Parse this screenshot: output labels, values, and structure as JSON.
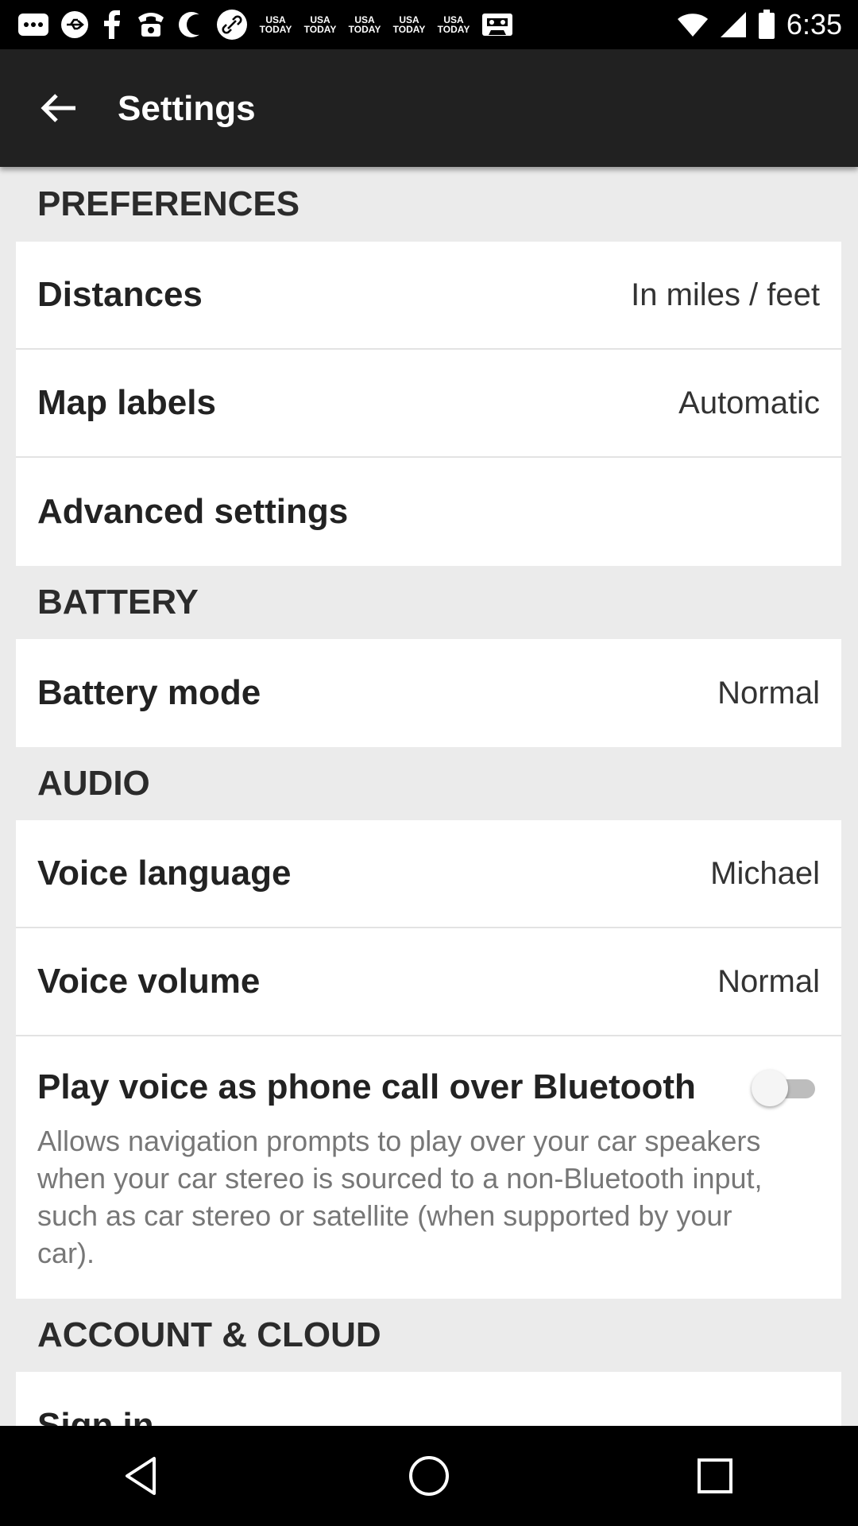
{
  "status_bar": {
    "time": "6:35",
    "notification_icons": [
      "message-icon",
      "usb-icon",
      "facebook-icon",
      "phone-icon",
      "moon-icon",
      "link-icon"
    ],
    "usa_today_text": [
      "USA TODAY",
      "USA TODAY",
      "USA TODAY",
      "USA TODAY",
      "USA TODAY"
    ]
  },
  "app_bar": {
    "title": "Settings"
  },
  "preferences": {
    "header": "PREFERENCES",
    "items": [
      {
        "label": "Distances",
        "value": "In miles / feet"
      },
      {
        "label": "Map labels",
        "value": "Automatic"
      },
      {
        "label": "Advanced settings",
        "value": ""
      }
    ]
  },
  "battery": {
    "header": "BATTERY",
    "items": [
      {
        "label": "Battery mode",
        "value": "Normal"
      }
    ]
  },
  "audio": {
    "header": "AUDIO",
    "items": [
      {
        "label": "Voice language",
        "value": "Michael"
      },
      {
        "label": "Voice volume",
        "value": "Normal"
      }
    ],
    "bluetooth": {
      "label": "Play voice as phone call over Bluetooth",
      "enabled": false,
      "description": "Allows navigation prompts to play over your car speakers when your car stereo is sourced to a non-Bluetooth input, such as car stereo or satellite (when supported by your car)."
    }
  },
  "account": {
    "header": "ACCOUNT & CLOUD",
    "items": [
      {
        "label": "Sign in"
      }
    ]
  },
  "colors": {
    "app_bar": "#212121",
    "background": "#ebebeb",
    "card": "#ffffff"
  }
}
